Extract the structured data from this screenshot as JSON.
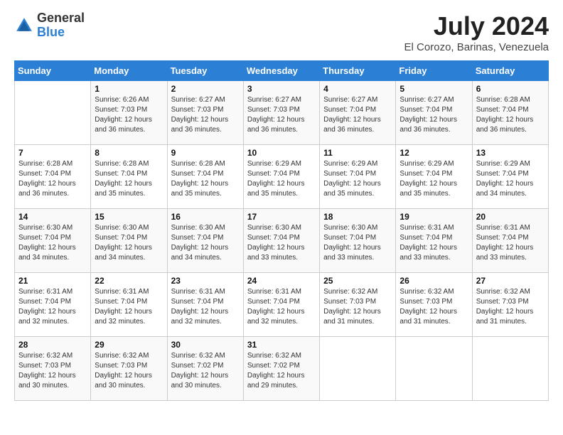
{
  "header": {
    "logo": {
      "general": "General",
      "blue": "Blue"
    },
    "title": "July 2024",
    "location": "El Corozo, Barinas, Venezuela"
  },
  "days_of_week": [
    "Sunday",
    "Monday",
    "Tuesday",
    "Wednesday",
    "Thursday",
    "Friday",
    "Saturday"
  ],
  "weeks": [
    [
      {
        "day": "",
        "sunrise": "",
        "sunset": "",
        "daylight": ""
      },
      {
        "day": "1",
        "sunrise": "6:26 AM",
        "sunset": "7:03 PM",
        "daylight": "12 hours and 36 minutes."
      },
      {
        "day": "2",
        "sunrise": "6:27 AM",
        "sunset": "7:03 PM",
        "daylight": "12 hours and 36 minutes."
      },
      {
        "day": "3",
        "sunrise": "6:27 AM",
        "sunset": "7:03 PM",
        "daylight": "12 hours and 36 minutes."
      },
      {
        "day": "4",
        "sunrise": "6:27 AM",
        "sunset": "7:04 PM",
        "daylight": "12 hours and 36 minutes."
      },
      {
        "day": "5",
        "sunrise": "6:27 AM",
        "sunset": "7:04 PM",
        "daylight": "12 hours and 36 minutes."
      },
      {
        "day": "6",
        "sunrise": "6:28 AM",
        "sunset": "7:04 PM",
        "daylight": "12 hours and 36 minutes."
      }
    ],
    [
      {
        "day": "7",
        "sunrise": "6:28 AM",
        "sunset": "7:04 PM",
        "daylight": "12 hours and 36 minutes."
      },
      {
        "day": "8",
        "sunrise": "6:28 AM",
        "sunset": "7:04 PM",
        "daylight": "12 hours and 35 minutes."
      },
      {
        "day": "9",
        "sunrise": "6:28 AM",
        "sunset": "7:04 PM",
        "daylight": "12 hours and 35 minutes."
      },
      {
        "day": "10",
        "sunrise": "6:29 AM",
        "sunset": "7:04 PM",
        "daylight": "12 hours and 35 minutes."
      },
      {
        "day": "11",
        "sunrise": "6:29 AM",
        "sunset": "7:04 PM",
        "daylight": "12 hours and 35 minutes."
      },
      {
        "day": "12",
        "sunrise": "6:29 AM",
        "sunset": "7:04 PM",
        "daylight": "12 hours and 35 minutes."
      },
      {
        "day": "13",
        "sunrise": "6:29 AM",
        "sunset": "7:04 PM",
        "daylight": "12 hours and 34 minutes."
      }
    ],
    [
      {
        "day": "14",
        "sunrise": "6:30 AM",
        "sunset": "7:04 PM",
        "daylight": "12 hours and 34 minutes."
      },
      {
        "day": "15",
        "sunrise": "6:30 AM",
        "sunset": "7:04 PM",
        "daylight": "12 hours and 34 minutes."
      },
      {
        "day": "16",
        "sunrise": "6:30 AM",
        "sunset": "7:04 PM",
        "daylight": "12 hours and 34 minutes."
      },
      {
        "day": "17",
        "sunrise": "6:30 AM",
        "sunset": "7:04 PM",
        "daylight": "12 hours and 33 minutes."
      },
      {
        "day": "18",
        "sunrise": "6:30 AM",
        "sunset": "7:04 PM",
        "daylight": "12 hours and 33 minutes."
      },
      {
        "day": "19",
        "sunrise": "6:31 AM",
        "sunset": "7:04 PM",
        "daylight": "12 hours and 33 minutes."
      },
      {
        "day": "20",
        "sunrise": "6:31 AM",
        "sunset": "7:04 PM",
        "daylight": "12 hours and 33 minutes."
      }
    ],
    [
      {
        "day": "21",
        "sunrise": "6:31 AM",
        "sunset": "7:04 PM",
        "daylight": "12 hours and 32 minutes."
      },
      {
        "day": "22",
        "sunrise": "6:31 AM",
        "sunset": "7:04 PM",
        "daylight": "12 hours and 32 minutes."
      },
      {
        "day": "23",
        "sunrise": "6:31 AM",
        "sunset": "7:04 PM",
        "daylight": "12 hours and 32 minutes."
      },
      {
        "day": "24",
        "sunrise": "6:31 AM",
        "sunset": "7:04 PM",
        "daylight": "12 hours and 32 minutes."
      },
      {
        "day": "25",
        "sunrise": "6:32 AM",
        "sunset": "7:03 PM",
        "daylight": "12 hours and 31 minutes."
      },
      {
        "day": "26",
        "sunrise": "6:32 AM",
        "sunset": "7:03 PM",
        "daylight": "12 hours and 31 minutes."
      },
      {
        "day": "27",
        "sunrise": "6:32 AM",
        "sunset": "7:03 PM",
        "daylight": "12 hours and 31 minutes."
      }
    ],
    [
      {
        "day": "28",
        "sunrise": "6:32 AM",
        "sunset": "7:03 PM",
        "daylight": "12 hours and 30 minutes."
      },
      {
        "day": "29",
        "sunrise": "6:32 AM",
        "sunset": "7:03 PM",
        "daylight": "12 hours and 30 minutes."
      },
      {
        "day": "30",
        "sunrise": "6:32 AM",
        "sunset": "7:02 PM",
        "daylight": "12 hours and 30 minutes."
      },
      {
        "day": "31",
        "sunrise": "6:32 AM",
        "sunset": "7:02 PM",
        "daylight": "12 hours and 29 minutes."
      },
      {
        "day": "",
        "sunrise": "",
        "sunset": "",
        "daylight": ""
      },
      {
        "day": "",
        "sunrise": "",
        "sunset": "",
        "daylight": ""
      },
      {
        "day": "",
        "sunrise": "",
        "sunset": "",
        "daylight": ""
      }
    ]
  ]
}
